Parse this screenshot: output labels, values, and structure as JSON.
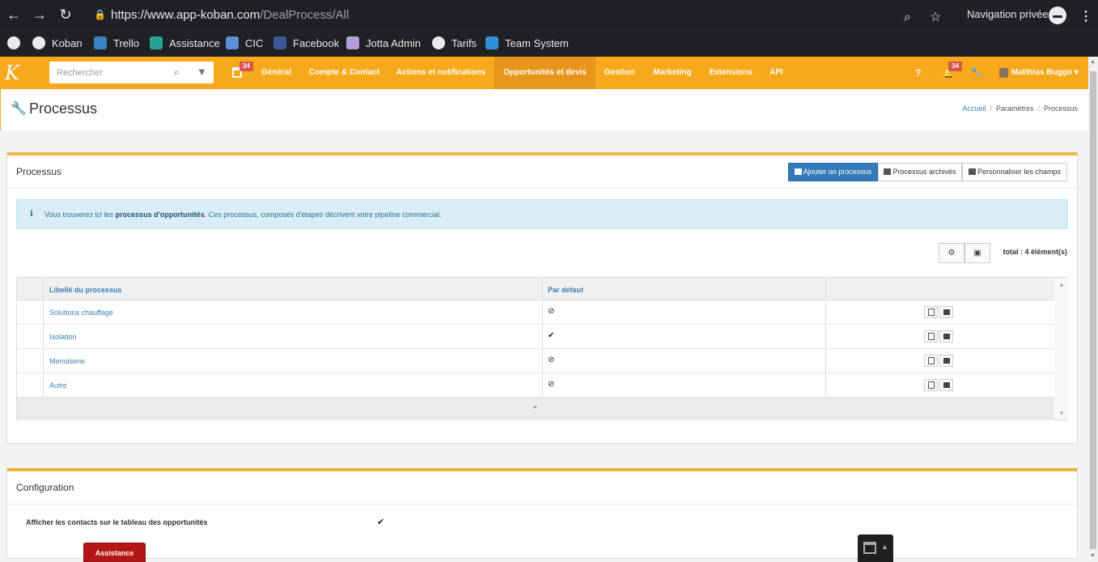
{
  "browser": {
    "url_host": "https://www.app-koban.com",
    "url_path": "/DealProcess/All",
    "incognito_label": "Navigation privée",
    "bookmarks": [
      {
        "label": "",
        "icon": "koban-icon",
        "color": "#e8eaed"
      },
      {
        "label": "Koban",
        "icon": "koban-icon",
        "color": "#e8eaed"
      },
      {
        "label": "Trello",
        "icon": "trello-icon",
        "color": "#3b82c4"
      },
      {
        "label": "Assistance",
        "icon": "headset-icon",
        "color": "#2aa198"
      },
      {
        "label": "CIC",
        "icon": "cic-icon",
        "color": "#5b8fd6"
      },
      {
        "label": "Facebook",
        "icon": "facebook-icon",
        "color": "#3b5998"
      },
      {
        "label": "Jotta Admin",
        "icon": "jotta-icon",
        "color": "#b39ddb"
      },
      {
        "label": "Tarifs",
        "icon": "globe-icon",
        "color": "#e8eaed"
      },
      {
        "label": "Team System",
        "icon": "teamsystem-icon",
        "color": "#2f8fd8"
      }
    ]
  },
  "header": {
    "search_placeholder": "Rechercher",
    "calendar_badge": "34",
    "notif_badge": "34",
    "menu": [
      {
        "label": "Général",
        "active": false
      },
      {
        "label": "Compte & Contact",
        "active": false
      },
      {
        "label": "Actions et notifications",
        "active": false
      },
      {
        "label": "Opportunités et devis",
        "active": true
      },
      {
        "label": "Gestion",
        "active": false
      },
      {
        "label": "Marketing",
        "active": false
      },
      {
        "label": "Extensions",
        "active": false
      },
      {
        "label": "API",
        "active": false
      }
    ],
    "user_name": "Matthias Buggo",
    "help_icon": "?",
    "accent": "#f7a81b"
  },
  "page": {
    "title": "Processus",
    "breadcrumb": [
      "Accueil",
      "Paramètres",
      "Processus"
    ]
  },
  "processus_panel": {
    "title": "Processus",
    "buttons": {
      "add": "Ajouter un processus",
      "archived": "Processus archivés",
      "customize": "Personnaliser les champs"
    },
    "info": {
      "prefix": "Vous trouverez ici les ",
      "bold": "processus d'opportunités",
      "suffix": ". Ces processus, composés d'étapes décrivent votre pipeline commercial."
    },
    "total": "total : 4 élément(s)",
    "table": {
      "columns": [
        "Libellé du processus",
        "Par défaut",
        ""
      ],
      "rows": [
        {
          "label": "Solutions chauffage",
          "default": "⊘"
        },
        {
          "label": "Isolation",
          "default": "✔"
        },
        {
          "label": "Menuiserie",
          "default": "⊘"
        },
        {
          "label": "Autre",
          "default": "⊘"
        }
      ]
    }
  },
  "config_panel": {
    "title": "Configuration",
    "rows": [
      {
        "label": "Afficher les contacts sur le tableau des opportunités",
        "value": "✔"
      }
    ]
  },
  "assistance_button": "Assistance"
}
